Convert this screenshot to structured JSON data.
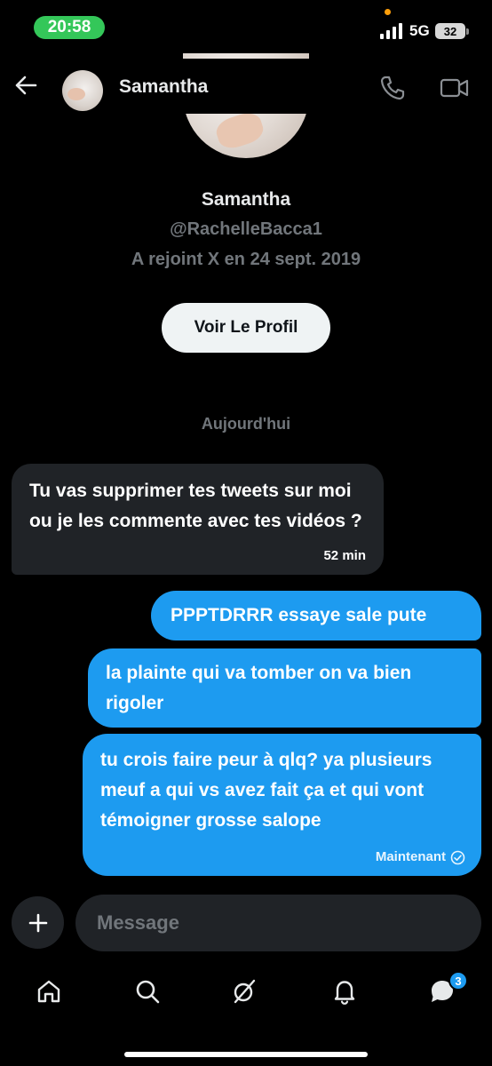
{
  "status_bar": {
    "time": "20:58",
    "network": "5G",
    "battery": "32"
  },
  "header": {
    "name": "Samantha"
  },
  "profile": {
    "name": "Samantha",
    "handle": "@RachelleBacca1",
    "joined": "A rejoint X en 24 sept. 2019",
    "button_label": "Voir Le Profil"
  },
  "date_separator": "Aujourd'hui",
  "messages": [
    {
      "direction": "incoming",
      "text": "Tu vas supprimer tes tweets sur moi ou je les commente avec tes vidéos ?",
      "time": "52 min"
    },
    {
      "direction": "outgoing",
      "text": "PPPTDRRR essaye sale pute"
    },
    {
      "direction": "outgoing",
      "text": "la plainte qui va tomber on va bien rigoler"
    },
    {
      "direction": "outgoing",
      "text": "tu crois faire peur à qlq? ya plusieurs meuf a qui vs avez fait ça et qui vont témoigner grosse salope",
      "status": "Maintenant"
    }
  ],
  "composer": {
    "placeholder": "Message"
  },
  "nav": {
    "messages_badge": "3"
  },
  "colors": {
    "background": "#000000",
    "accent": "#1d9bf0",
    "incoming_bubble": "#202327",
    "muted_text": "#71767b",
    "status_green": "#34c759"
  },
  "icons": [
    "arrow-left-icon",
    "phone-icon",
    "video-camera-icon",
    "plus-icon",
    "home-icon",
    "search-icon",
    "grok-icon",
    "bell-icon",
    "messages-icon",
    "read-check-icon"
  ]
}
